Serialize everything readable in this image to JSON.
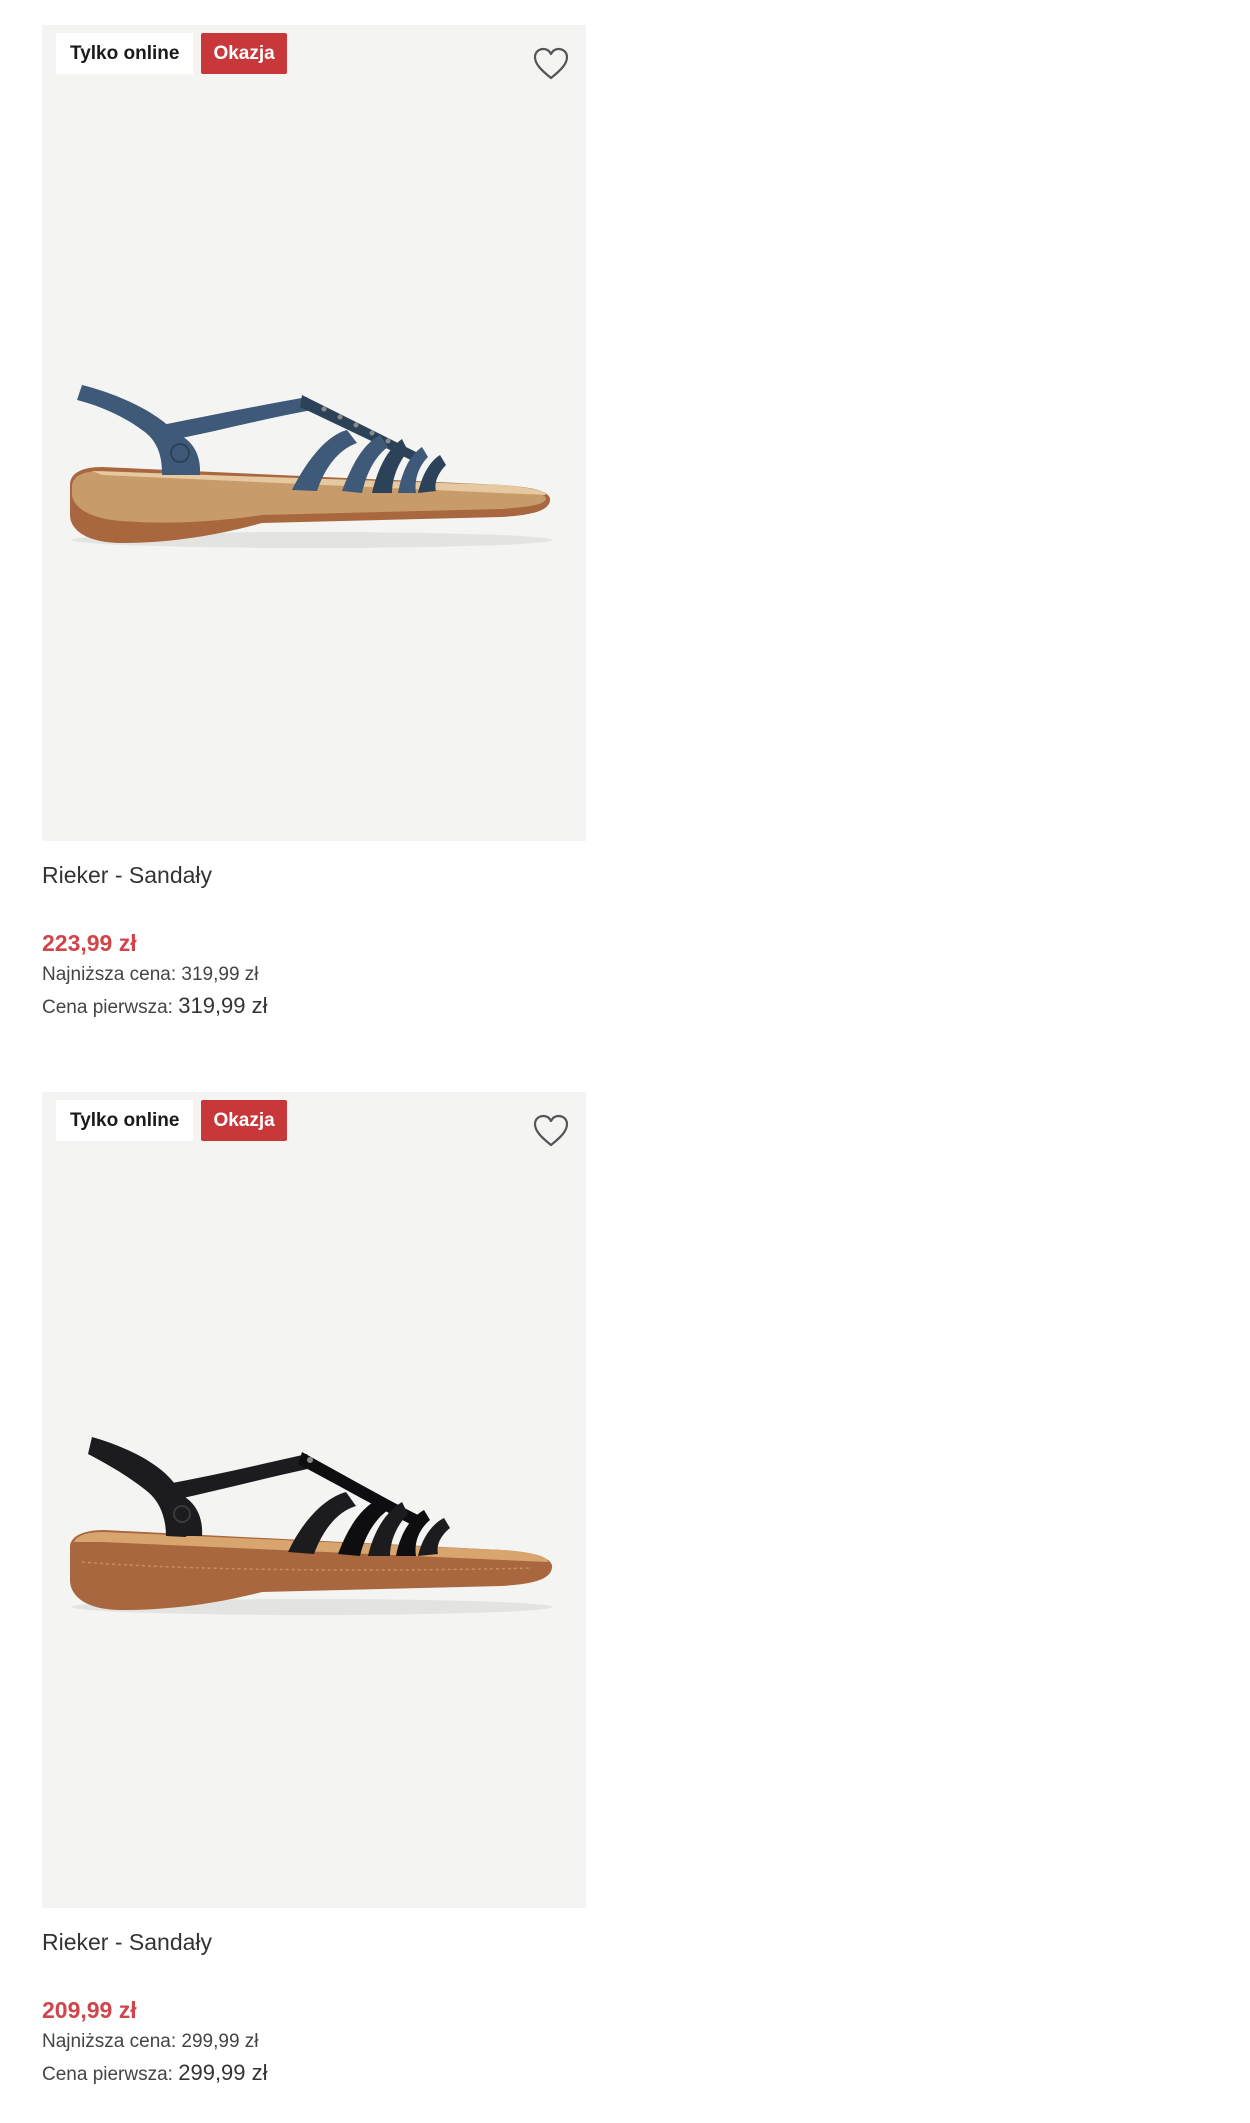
{
  "products": [
    {
      "badges": {
        "online": "Tylko online",
        "sale": "Okazja"
      },
      "name": "Rieker - Sandały",
      "price": "223,99 zł",
      "lowest_label": "Najniższa cena:",
      "lowest_value": "319,99 zł",
      "first_label": "Cena pierwsza:",
      "first_value": "319,99 zł",
      "colors": {
        "upper": "#3f5a78",
        "upper_dark": "#2c4259",
        "sole": "#a8673e",
        "cork": "#c89b6a"
      }
    },
    {
      "badges": {
        "online": "Tylko online",
        "sale": "Okazja"
      },
      "name": "Rieker - Sandały",
      "price": "209,99 zł",
      "lowest_label": "Najniższa cena:",
      "lowest_value": "299,99 zł",
      "first_label": "Cena pierwsza:",
      "first_value": "299,99 zł",
      "colors": {
        "upper": "#1c1c1e",
        "upper_dark": "#0e0e10",
        "sole": "#a8673e",
        "cork": "#c98d5c"
      }
    }
  ],
  "icons": {
    "wishlist": "heart-outline-icon"
  },
  "accent_colors": {
    "sale_badge": "#c8373a",
    "price": "#d0454b",
    "image_bg": "#f4f4f3"
  }
}
